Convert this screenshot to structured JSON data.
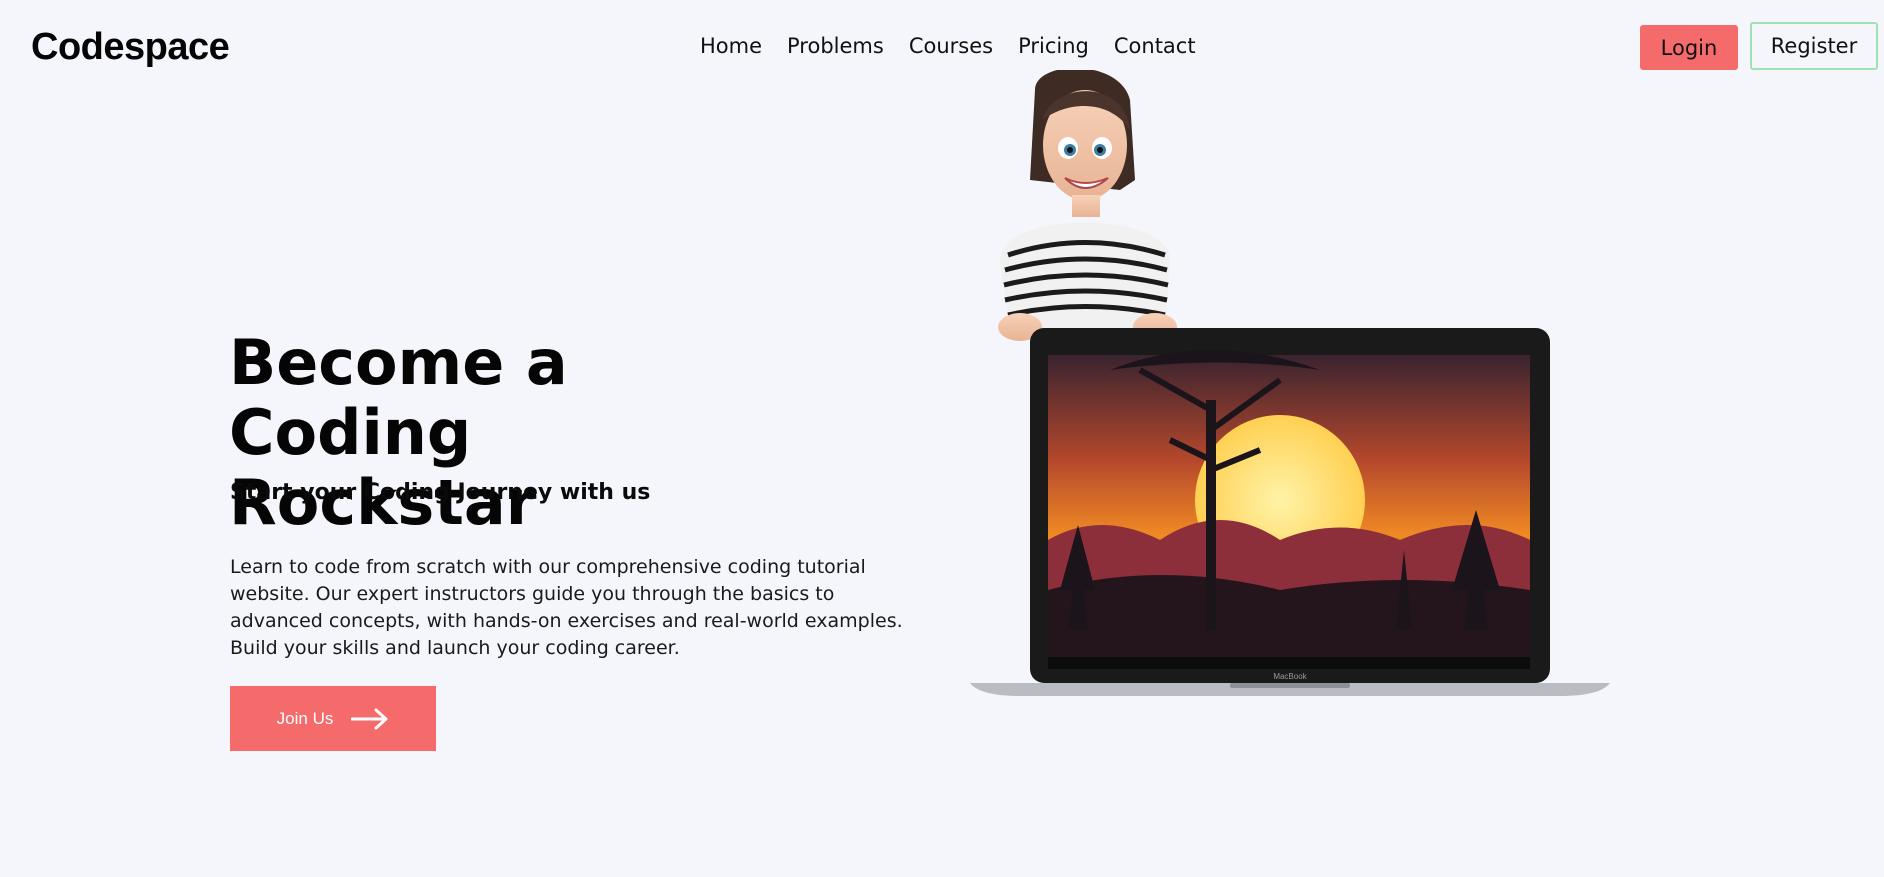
{
  "brand": {
    "name": "Codespace"
  },
  "nav": {
    "items": [
      {
        "label": "Home"
      },
      {
        "label": "Problems"
      },
      {
        "label": "Courses"
      },
      {
        "label": "Pricing"
      },
      {
        "label": "Contact"
      }
    ]
  },
  "auth": {
    "login_label": "Login",
    "register_label": "Register"
  },
  "hero": {
    "title": "Become a Coding Rockstar",
    "subtitle": "Start your Coding Journey with us",
    "description": "Learn to code from scratch with our comprehensive coding tutorial website. Our expert instructors guide you through the basics to advanced concepts, with hands-on exercises and real-world examples. Build your skills and launch your coding career.",
    "cta_label": "Join Us",
    "cta_icon": "arrow-right-icon"
  },
  "illustration": {
    "laptop_brand": "MacBook"
  },
  "colors": {
    "background": "#f5f6fc",
    "accent": "#f56b6b",
    "register_border": "#9fe0b4"
  }
}
